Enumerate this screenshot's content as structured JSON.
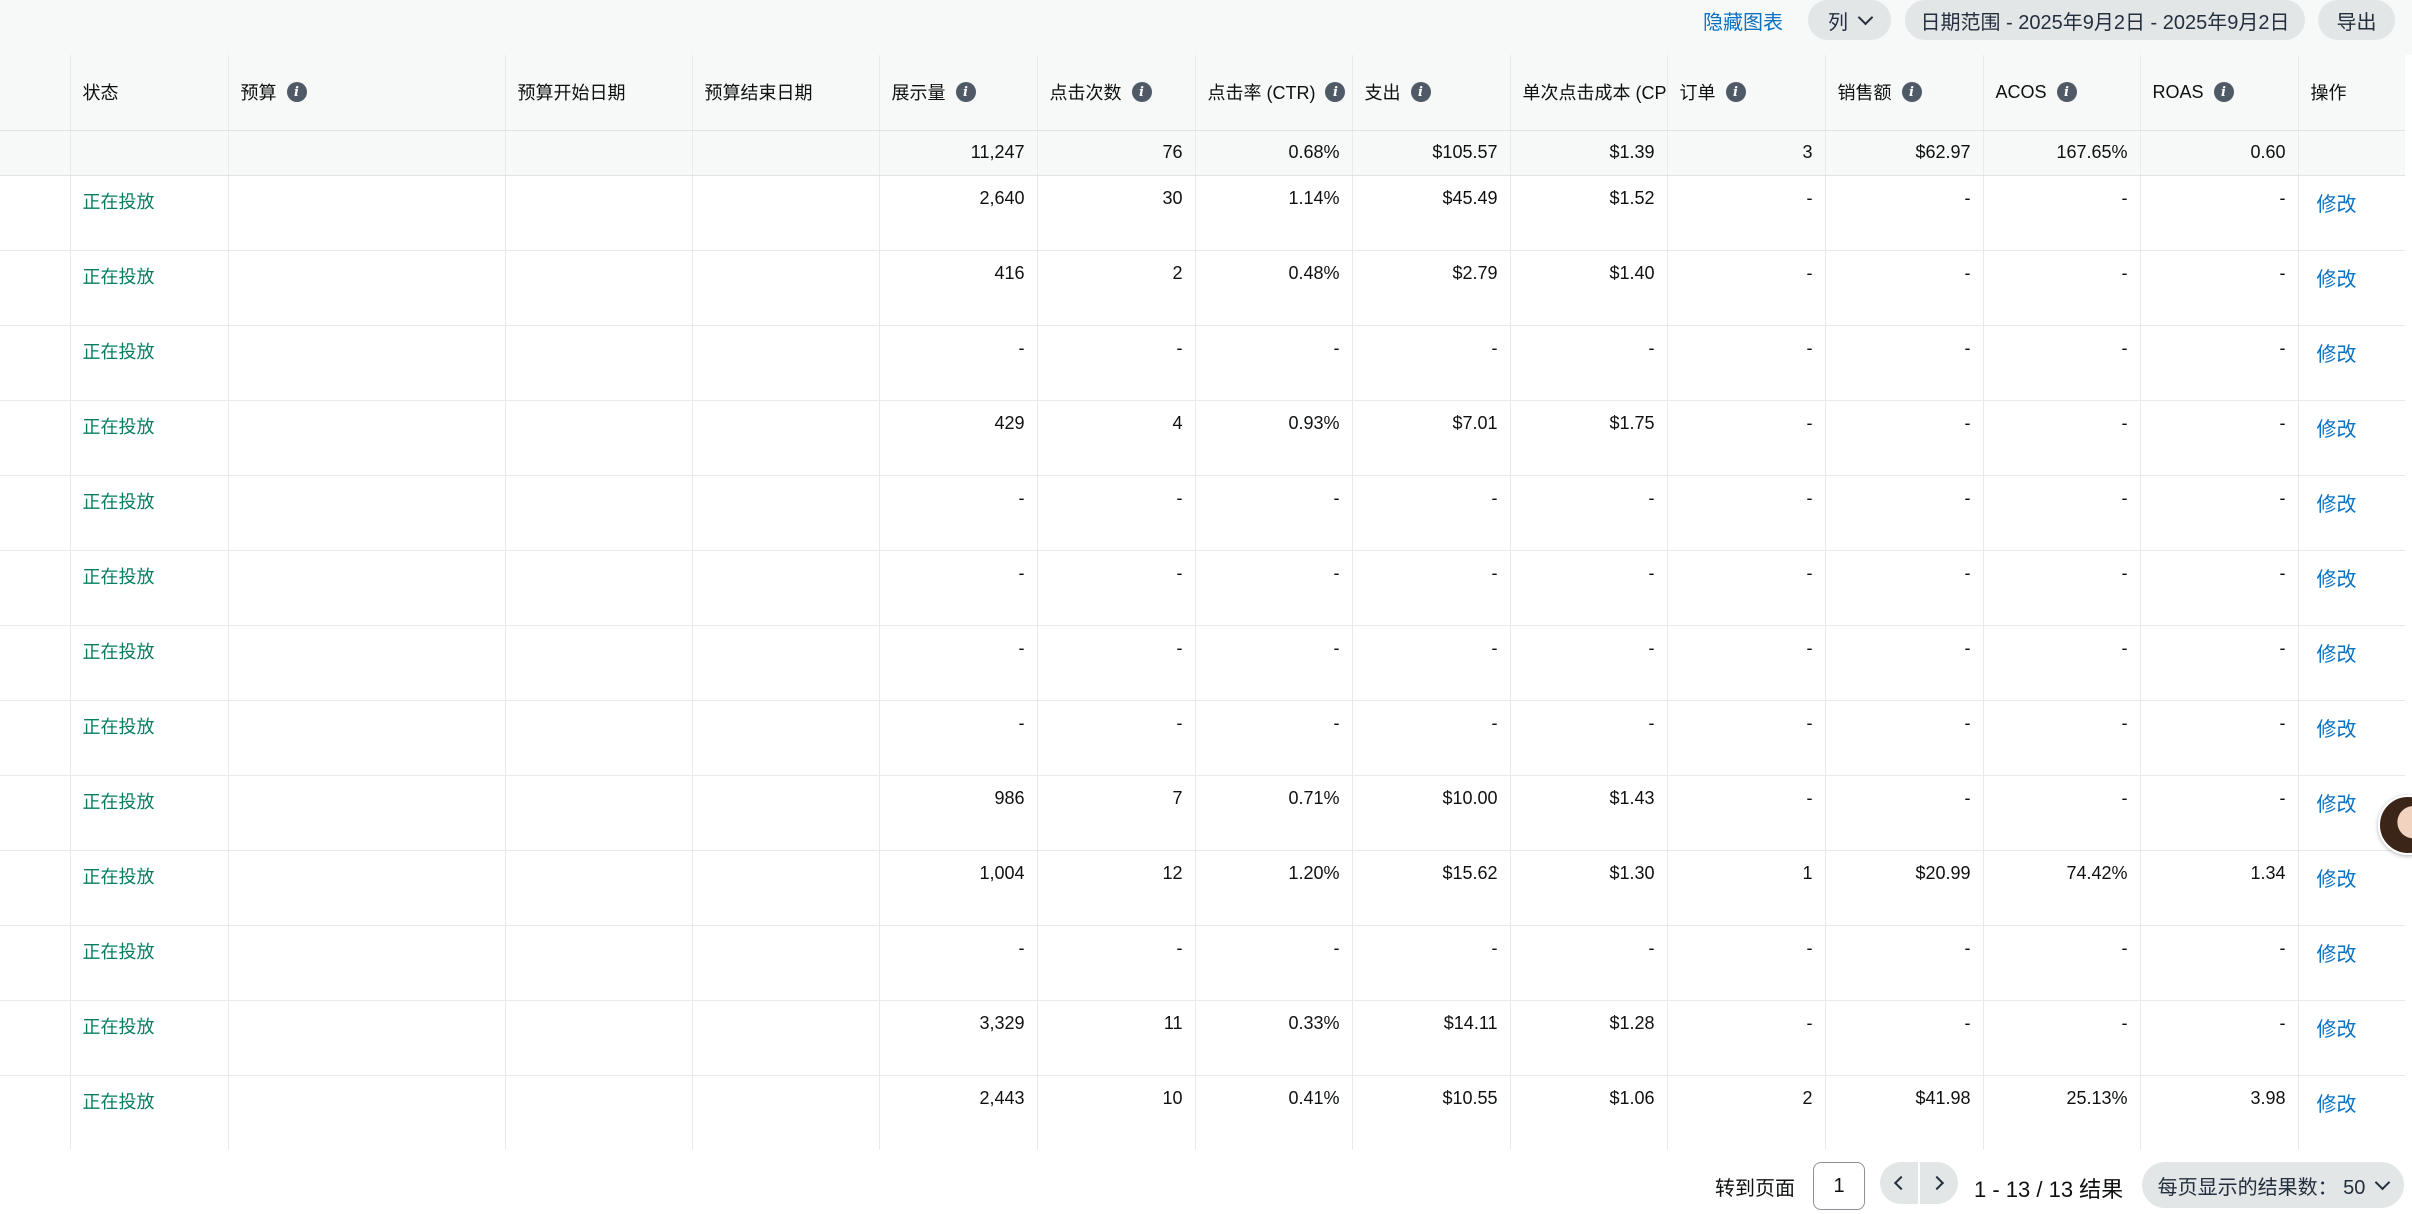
{
  "toolbar": {
    "hide_chart": "隐藏图表",
    "columns": "列",
    "date_range": "日期范围 - 2025年9月2日 - 2025年9月2日",
    "export": "导出"
  },
  "table": {
    "headers": {
      "status": "状态",
      "budget": "预算",
      "budget_start": "预算开始日期",
      "budget_end": "预算结束日期",
      "impressions": "展示量",
      "clicks": "点击次数",
      "ctr": "点击率 (CTR)",
      "spend": "支出",
      "cpc": "单次点击成本 (CPC)",
      "orders": "订单",
      "sales": "销售额",
      "acos": "ACOS",
      "roas": "ROAS",
      "actions": "操作"
    },
    "summary": {
      "impressions": "11,247",
      "clicks": "76",
      "ctr": "0.68%",
      "spend": "$105.57",
      "cpc": "$1.39",
      "orders": "3",
      "sales": "$62.97",
      "acos": "167.65%",
      "roas": "0.60"
    },
    "rows": [
      {
        "status": "正在投放",
        "impressions": "2,640",
        "clicks": "30",
        "ctr": "1.14%",
        "spend": "$45.49",
        "cpc": "$1.52",
        "orders": "-",
        "sales": "-",
        "acos": "-",
        "roas": "-",
        "action": "修改"
      },
      {
        "status": "正在投放",
        "impressions": "416",
        "clicks": "2",
        "ctr": "0.48%",
        "spend": "$2.79",
        "cpc": "$1.40",
        "orders": "-",
        "sales": "-",
        "acos": "-",
        "roas": "-",
        "action": "修改"
      },
      {
        "status": "正在投放",
        "impressions": "-",
        "clicks": "-",
        "ctr": "-",
        "spend": "-",
        "cpc": "-",
        "orders": "-",
        "sales": "-",
        "acos": "-",
        "roas": "-",
        "action": "修改"
      },
      {
        "status": "正在投放",
        "impressions": "429",
        "clicks": "4",
        "ctr": "0.93%",
        "spend": "$7.01",
        "cpc": "$1.75",
        "orders": "-",
        "sales": "-",
        "acos": "-",
        "roas": "-",
        "action": "修改"
      },
      {
        "status": "正在投放",
        "impressions": "-",
        "clicks": "-",
        "ctr": "-",
        "spend": "-",
        "cpc": "-",
        "orders": "-",
        "sales": "-",
        "acos": "-",
        "roas": "-",
        "action": "修改"
      },
      {
        "status": "正在投放",
        "impressions": "-",
        "clicks": "-",
        "ctr": "-",
        "spend": "-",
        "cpc": "-",
        "orders": "-",
        "sales": "-",
        "acos": "-",
        "roas": "-",
        "action": "修改"
      },
      {
        "status": "正在投放",
        "impressions": "-",
        "clicks": "-",
        "ctr": "-",
        "spend": "-",
        "cpc": "-",
        "orders": "-",
        "sales": "-",
        "acos": "-",
        "roas": "-",
        "action": "修改"
      },
      {
        "status": "正在投放",
        "impressions": "-",
        "clicks": "-",
        "ctr": "-",
        "spend": "-",
        "cpc": "-",
        "orders": "-",
        "sales": "-",
        "acos": "-",
        "roas": "-",
        "action": "修改"
      },
      {
        "status": "正在投放",
        "impressions": "986",
        "clicks": "7",
        "ctr": "0.71%",
        "spend": "$10.00",
        "cpc": "$1.43",
        "orders": "-",
        "sales": "-",
        "acos": "-",
        "roas": "-",
        "action": "修改"
      },
      {
        "status": "正在投放",
        "impressions": "1,004",
        "clicks": "12",
        "ctr": "1.20%",
        "spend": "$15.62",
        "cpc": "$1.30",
        "orders": "1",
        "sales": "$20.99",
        "acos": "74.42%",
        "roas": "1.34",
        "action": "修改"
      },
      {
        "status": "正在投放",
        "impressions": "-",
        "clicks": "-",
        "ctr": "-",
        "spend": "-",
        "cpc": "-",
        "orders": "-",
        "sales": "-",
        "acos": "-",
        "roas": "-",
        "action": "修改"
      },
      {
        "status": "正在投放",
        "impressions": "3,329",
        "clicks": "11",
        "ctr": "0.33%",
        "spend": "$14.11",
        "cpc": "$1.28",
        "orders": "-",
        "sales": "-",
        "acos": "-",
        "roas": "-",
        "action": "修改"
      },
      {
        "status": "正在投放",
        "impressions": "2,443",
        "clicks": "10",
        "ctr": "0.41%",
        "spend": "$10.55",
        "cpc": "$1.06",
        "orders": "2",
        "sales": "$41.98",
        "acos": "25.13%",
        "roas": "3.98",
        "action": "修改"
      }
    ]
  },
  "footer": {
    "goto_label": "转到页面",
    "page_value": "1",
    "result_count": "1 - 13 / 13 结果",
    "per_page": "每页显示的结果数： 50"
  },
  "colors": {
    "status_active": "#067d62",
    "link": "#0b71c1",
    "header_bg": "#f7f8f8",
    "pill_bg": "#e3e6e6"
  }
}
